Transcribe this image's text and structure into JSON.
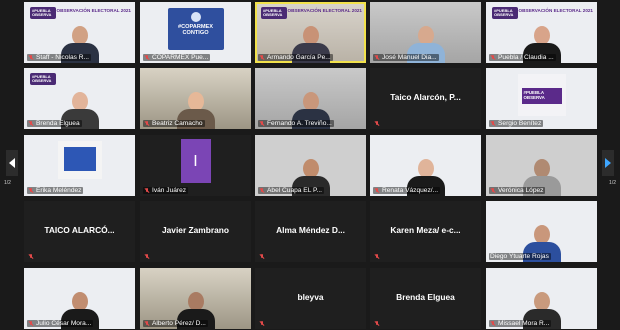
{
  "pager": {
    "left": "1/2",
    "right": "1/2"
  },
  "tiles": [
    {
      "name": "Staff - Nicolas R...",
      "big": "",
      "bg": "bg-white",
      "kind": "person-branded",
      "mic_muted": true,
      "active": false,
      "brand": "#PUEBLA OBSERVA",
      "elect": "OBSERVACIÓN ELECTORAL 2021",
      "skin": "#d1a184",
      "shirt": "#2b3243"
    },
    {
      "name": "COPARMEX Pue...",
      "big": "",
      "bg": "bg-white",
      "kind": "logo",
      "mic_muted": true,
      "active": false,
      "logo_text": "#COPARMEX CONTIGO"
    },
    {
      "name": "Armando García Pe...",
      "big": "",
      "bg": "bg-office",
      "kind": "person-branded",
      "mic_muted": true,
      "active": true,
      "brand": "#PUEBLA OBSERVA",
      "elect": "OBSERVACIÓN ELECTORAL 2021",
      "skin": "#c89276",
      "shirt": "#3a3a4a"
    },
    {
      "name": "José Manuel Dia...",
      "big": "",
      "bg": "bg-wall",
      "kind": "person",
      "mic_muted": true,
      "active": false,
      "skin": "#d7a98e",
      "shirt": "#8fb3d8"
    },
    {
      "name": "Puebla / Claudia ...",
      "big": "",
      "bg": "bg-white",
      "kind": "person-branded",
      "mic_muted": true,
      "active": false,
      "brand": "#PUEBLA OBSERVA",
      "elect": "OBSERVACIÓN ELECTORAL 2021",
      "skin": "#d8a48a",
      "shirt": "#1a1a1a"
    },
    {
      "name": "Brenda Elguea",
      "big": "",
      "bg": "bg-white",
      "kind": "person-branded",
      "mic_muted": true,
      "active": false,
      "brand": "#PUEBLA OBSERVA",
      "elect": "",
      "skin": "#e2b49a",
      "shirt": "#3a3a3a"
    },
    {
      "name": "Beatriz Camacho",
      "big": "",
      "bg": "bg-room",
      "kind": "person",
      "mic_muted": true,
      "active": false,
      "skin": "#e6b898",
      "shirt": "#6b5a4a"
    },
    {
      "name": "Fernando A. Treviño...",
      "big": "",
      "bg": "bg-wall",
      "kind": "person",
      "mic_muted": true,
      "active": false,
      "skin": "#c9977b",
      "shirt": "#2b3243"
    },
    {
      "name": "",
      "big": "Taico Alarcón, P...",
      "bg": "",
      "kind": "name-only",
      "mic_muted": true,
      "active": false
    },
    {
      "name": "Sergio Benítez",
      "big": "",
      "bg": "bg-white",
      "kind": "observa",
      "mic_muted": true,
      "active": false,
      "obs_text": "#PUEBLA OBSERVA"
    },
    {
      "name": "Erika Meléndez",
      "big": "",
      "bg": "bg-white",
      "kind": "copa",
      "mic_muted": true,
      "active": false
    },
    {
      "name": "Iván Juárez",
      "big": "",
      "bg": "",
      "kind": "letter",
      "mic_muted": true,
      "active": false,
      "letter": "I"
    },
    {
      "name": "Abel Cuapa EL P...",
      "big": "",
      "bg": "bg-grey",
      "kind": "person",
      "mic_muted": true,
      "active": false,
      "skin": "#c08c6c",
      "shirt": "#2a2a2a"
    },
    {
      "name": "Renata Vázquez/...",
      "big": "",
      "bg": "bg-white",
      "kind": "person",
      "mic_muted": true,
      "active": false,
      "skin": "#e0b49a",
      "shirt": "#1a1a1a"
    },
    {
      "name": "Verónica López",
      "big": "",
      "bg": "bg-grey",
      "kind": "person",
      "mic_muted": true,
      "active": false,
      "skin": "#b08a72",
      "shirt": "#9a9a9a"
    },
    {
      "name": "",
      "big": "TAICO ALARCÓ...",
      "bg": "",
      "kind": "name-only",
      "mic_muted": true,
      "active": false
    },
    {
      "name": "",
      "big": "Javier Zambrano",
      "bg": "",
      "kind": "name-only",
      "mic_muted": true,
      "active": false
    },
    {
      "name": "",
      "big": "Alma Méndez D...",
      "bg": "",
      "kind": "name-only",
      "mic_muted": true,
      "active": false
    },
    {
      "name": "",
      "big": "Karen Meza/ e-c...",
      "bg": "",
      "kind": "name-only",
      "mic_muted": true,
      "active": false
    },
    {
      "name": "Diego Ytuarte Rojas",
      "big": "",
      "bg": "bg-white",
      "kind": "person",
      "mic_muted": false,
      "active": false,
      "skin": "#c9977b",
      "shirt": "#2c4f9e"
    },
    {
      "name": "Julio César Mora...",
      "big": "",
      "bg": "bg-white",
      "kind": "person",
      "mic_muted": true,
      "active": false,
      "skin": "#c18d70",
      "shirt": "#1a1a1a"
    },
    {
      "name": "Alberto Pérez/ D...",
      "big": "",
      "bg": "bg-room",
      "kind": "person",
      "mic_muted": true,
      "active": false,
      "skin": "#a97b62",
      "shirt": "#1a1a1a"
    },
    {
      "name": "",
      "big": "bleyva",
      "bg": "",
      "kind": "name-only",
      "mic_muted": true,
      "active": false
    },
    {
      "name": "",
      "big": "Brenda Elguea",
      "bg": "",
      "kind": "name-only",
      "mic_muted": true,
      "active": false
    },
    {
      "name": "Missael Mora R...",
      "big": "",
      "bg": "bg-white",
      "kind": "person",
      "mic_muted": true,
      "active": false,
      "skin": "#c99a7d",
      "shirt": "#2a2a2a"
    }
  ]
}
